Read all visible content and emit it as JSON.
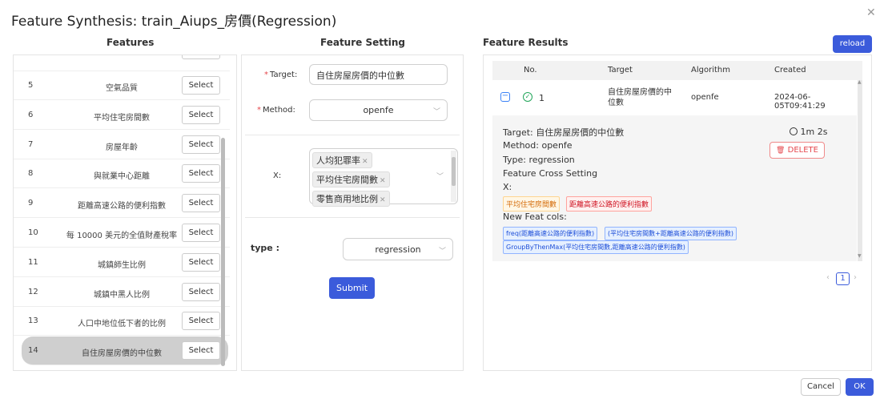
{
  "title": "Feature Synthesis: train_Aiups_房價(Regression)",
  "headers": {
    "features": "Features",
    "setting": "Feature Setting",
    "results": "Feature Results"
  },
  "features": [
    {
      "num": "5",
      "name": "空氣品質",
      "btn": "Select"
    },
    {
      "num": "6",
      "name": "平均住宅房間數",
      "btn": "Select"
    },
    {
      "num": "7",
      "name": "房屋年齡",
      "btn": "Select"
    },
    {
      "num": "8",
      "name": "與就業中心距離",
      "btn": "Select"
    },
    {
      "num": "9",
      "name": "距離高速公路的便利指數",
      "btn": "Select"
    },
    {
      "num": "10",
      "name": "每 10000 美元的全值財產稅率",
      "btn": "Select"
    },
    {
      "num": "11",
      "name": "城鎮師生比例",
      "btn": "Select"
    },
    {
      "num": "12",
      "name": "城鎮中黑人比例",
      "btn": "Select"
    },
    {
      "num": "13",
      "name": "人口中地位低下者的比例",
      "btn": "Select"
    },
    {
      "num": "14",
      "name": "自住房屋房價的中位數",
      "btn": "Select"
    }
  ],
  "setting": {
    "target_label": "Target:",
    "target_value": "自住房屋房價的中位數",
    "method_label": "Method:",
    "method_value": "openfe",
    "x_label": "X:",
    "x_tags": [
      "人均犯罪率",
      "平均住宅房間數",
      "零售商用地比例"
    ],
    "type_label": "type :",
    "type_value": "regression",
    "submit_label": "Submit"
  },
  "results": {
    "reload_label": "reload",
    "columns": [
      "No.",
      "Target",
      "Algorithm",
      "Created"
    ],
    "row": {
      "no": "1",
      "target": "自住房屋房價的中位數",
      "algorithm": "openfe",
      "created": "2024-06-05T09:41:29"
    },
    "detail": {
      "target_line": "Target: 自住房屋房價的中位數",
      "method_line": "Method: openfe",
      "type_line": "Type: regression",
      "cross_line": "Feature Cross Setting",
      "x_line": "X:",
      "x_pills": [
        "平均住宅房間數",
        "距離高速公路的便利指數"
      ],
      "new_feat_line": "New Feat cols:",
      "new_feats": [
        "freq(距離高速公路的便利指數)",
        "(平均住宅房間數+距離高速公路的便利指數)",
        "GroupByThenMax(平均住宅房間數,距離高速公路的便利指數)"
      ],
      "duration": "1m 2s",
      "delete_label": "DELETE"
    },
    "page": "1"
  },
  "footer": {
    "cancel": "Cancel",
    "ok": "OK"
  },
  "colors": {
    "primary": "#3b5bdb",
    "danger": "#e5484d"
  }
}
